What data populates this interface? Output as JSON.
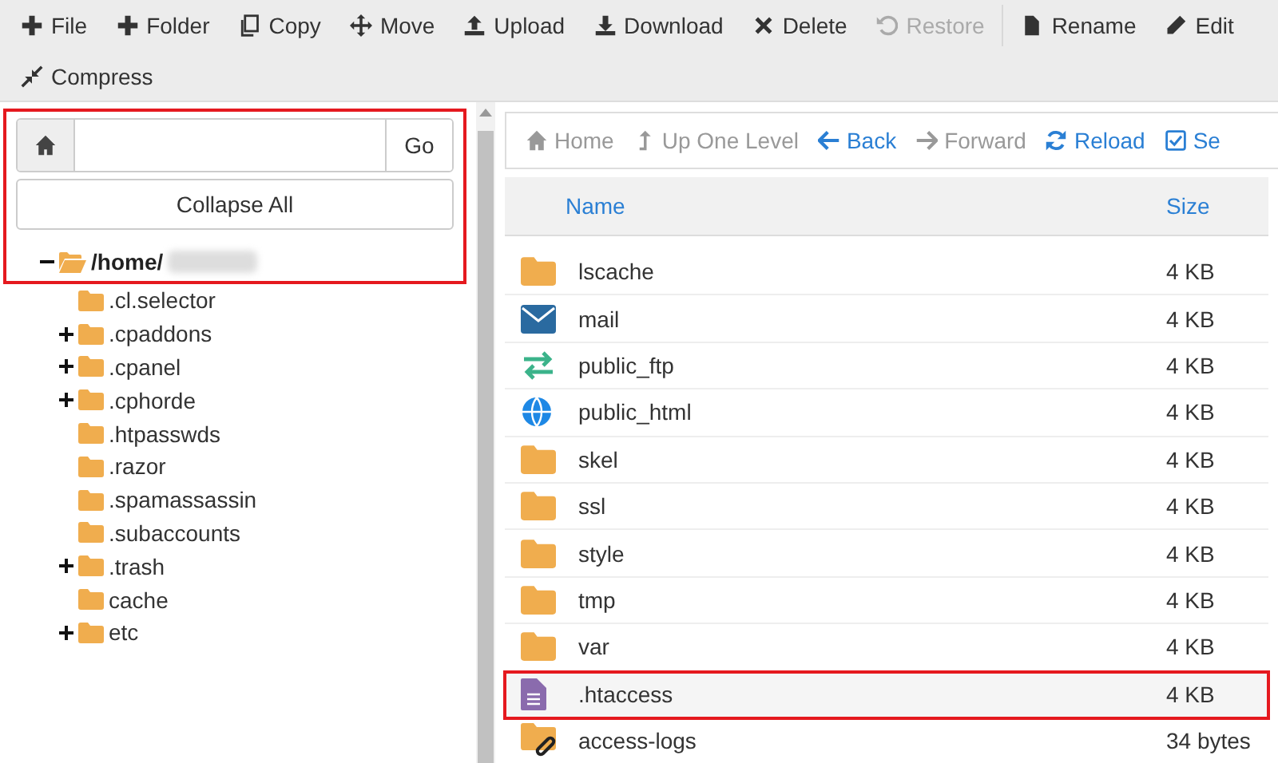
{
  "toolbar": {
    "items": [
      {
        "label": "File",
        "disabled": false
      },
      {
        "label": "Folder",
        "disabled": false
      },
      {
        "label": "Copy",
        "disabled": false
      },
      {
        "label": "Move",
        "disabled": false
      },
      {
        "label": "Upload",
        "disabled": false
      },
      {
        "label": "Download",
        "disabled": false
      },
      {
        "label": "Delete",
        "disabled": false
      },
      {
        "label": "Restore",
        "disabled": true
      },
      {
        "label": "Rename",
        "disabled": false
      },
      {
        "label": "Edit",
        "disabled": false
      },
      {
        "label": "Compress",
        "disabled": false
      }
    ]
  },
  "sidebar": {
    "highlighted": true,
    "go_button": "Go",
    "collapse_button": "Collapse All",
    "tree": {
      "label": "/home/",
      "expanded": true,
      "children": [
        {
          "label": ".cl.selector",
          "has_children": false
        },
        {
          "label": ".cpaddons",
          "has_children": true
        },
        {
          "label": ".cpanel",
          "has_children": true
        },
        {
          "label": ".cphorde",
          "has_children": true
        },
        {
          "label": ".htpasswds",
          "has_children": false
        },
        {
          "label": ".razor",
          "has_children": false
        },
        {
          "label": ".spamassassin",
          "has_children": false
        },
        {
          "label": ".subaccounts",
          "has_children": false
        },
        {
          "label": ".trash",
          "has_children": true
        },
        {
          "label": "cache",
          "has_children": false
        },
        {
          "label": "etc",
          "has_children": true
        }
      ]
    }
  },
  "navigation": [
    {
      "label": "Home",
      "disabled": true
    },
    {
      "label": "Up One Level",
      "disabled": true
    },
    {
      "label": "Back",
      "disabled": false
    },
    {
      "label": "Forward",
      "disabled": true
    },
    {
      "label": "Reload",
      "disabled": false
    },
    {
      "label": "Se",
      "disabled": false
    }
  ],
  "table": {
    "columns": [
      "Name",
      "Size"
    ],
    "rows": [
      {
        "kind": "folder",
        "name": "lscache",
        "size": "4 KB",
        "highlighted": false
      },
      {
        "kind": "mail",
        "name": "mail",
        "size": "4 KB",
        "highlighted": false
      },
      {
        "kind": "ftp",
        "name": "public_ftp",
        "size": "4 KB",
        "highlighted": false
      },
      {
        "kind": "web",
        "name": "public_html",
        "size": "4 KB",
        "highlighted": false
      },
      {
        "kind": "folder",
        "name": "skel",
        "size": "4 KB",
        "highlighted": false
      },
      {
        "kind": "folder",
        "name": "ssl",
        "size": "4 KB",
        "highlighted": false
      },
      {
        "kind": "folder",
        "name": "style",
        "size": "4 KB",
        "highlighted": false
      },
      {
        "kind": "folder",
        "name": "tmp",
        "size": "4 KB",
        "highlighted": false
      },
      {
        "kind": "folder",
        "name": "var",
        "size": "4 KB",
        "highlighted": false
      },
      {
        "kind": "file",
        "name": ".htaccess",
        "size": "4 KB",
        "highlighted": true
      },
      {
        "kind": "link",
        "name": "access-logs",
        "size": "34 bytes",
        "highlighted": false
      }
    ]
  }
}
